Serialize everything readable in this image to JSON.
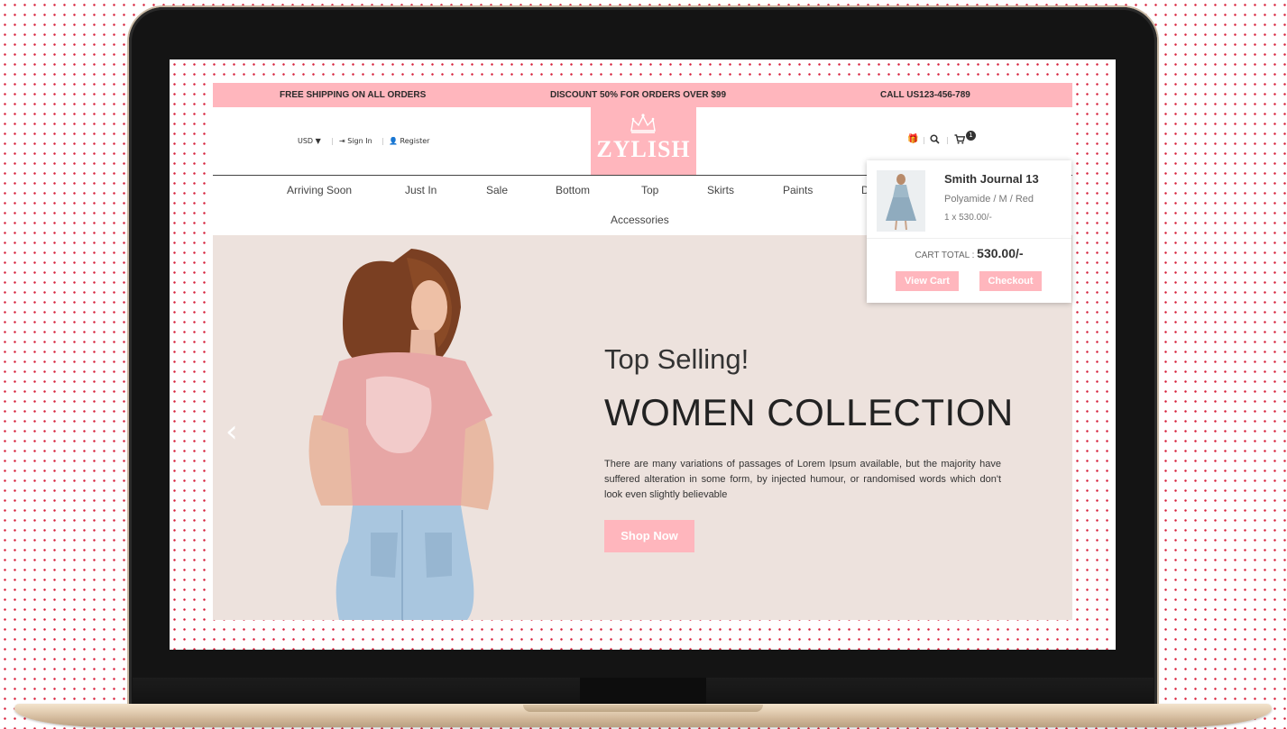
{
  "topbar": {
    "shipping": "FREE SHIPPING ON ALL ORDERS",
    "discount": "DISCOUNT 50% FOR ORDERS OVER $99",
    "phone": "CALL US123-456-789"
  },
  "header": {
    "currency": "USD ▼",
    "sign_in": "Sign In",
    "register": "Register",
    "logo_text": "ZYLISH",
    "cart_count": "1",
    "icons": [
      "gift-icon",
      "search-icon",
      "cart-icon"
    ]
  },
  "nav": {
    "items": [
      "Arriving Soon",
      "Just In",
      "Sale",
      "Bottom",
      "Top",
      "Skirts",
      "Paints",
      "D",
      "Accessories"
    ]
  },
  "hero": {
    "subtitle": "Top Selling!",
    "title": "WOMEN COLLECTION",
    "description": "There are many variations of passages of Lorem Ipsum available, but the majority have suffered alteration in some form, by injected humour, or randomised words which don't look even slightly believable",
    "cta": "Shop Now",
    "prev_arrow": "‹"
  },
  "cart": {
    "item_name": "Smith Journal 13",
    "item_variant": "Polyamide / M / Red",
    "item_qty": "1 x 530.00/-",
    "total_label": "CART TOTAL :",
    "total_value": "530.00/-",
    "view_cart": "View Cart",
    "checkout": "Checkout"
  },
  "colors": {
    "brand_pink": "#ffb6bd",
    "hero_bg": "#ede2dd",
    "dot_pattern": "#d6203a"
  }
}
